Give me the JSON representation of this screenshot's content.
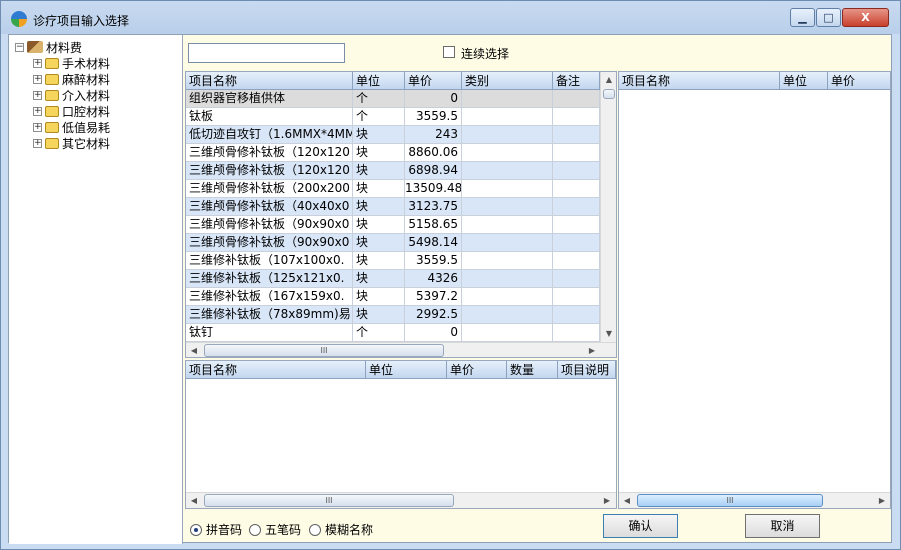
{
  "window": {
    "title": "诊疗项目输入选择",
    "minimize_glyph": "▁",
    "maximize_glyph": "□",
    "close_glyph": "X"
  },
  "tree": {
    "root": {
      "label": "材料费",
      "icon": "book-icon",
      "expander": "⊟"
    },
    "children": [
      {
        "label": "手术材料",
        "expander": "⊞"
      },
      {
        "label": "麻醉材料",
        "expander": "⊞"
      },
      {
        "label": "介入材料",
        "expander": "⊞"
      },
      {
        "label": "口腔材料",
        "expander": "⊞"
      },
      {
        "label": "低值易耗",
        "expander": "⊞"
      },
      {
        "label": "其它材料",
        "expander": "⊞"
      }
    ]
  },
  "search": {
    "value": ""
  },
  "continuous": {
    "label": "连续选择",
    "checked": false
  },
  "catalog": {
    "columns": [
      "项目名称",
      "单位",
      "单价",
      "类别",
      "备注"
    ],
    "rows": [
      [
        "组织器官移植供体",
        "个",
        "0",
        "",
        ""
      ],
      [
        "钛板",
        "个",
        "3559.5",
        "",
        ""
      ],
      [
        "低切迹自攻钉（1.6MMX*4MM",
        "块",
        "243",
        "",
        ""
      ],
      [
        "三维颅骨修补钛板（120x120",
        "块",
        "8860.06",
        "",
        ""
      ],
      [
        "三维颅骨修补钛板（120x120",
        "块",
        "6898.94",
        "",
        ""
      ],
      [
        "三维颅骨修补钛板（200x200",
        "块",
        "13509.48",
        "",
        ""
      ],
      [
        "三维颅骨修补钛板（40x40x0",
        "块",
        "3123.75",
        "",
        ""
      ],
      [
        "三维颅骨修补钛板（90x90x0",
        "块",
        "5158.65",
        "",
        ""
      ],
      [
        "三维颅骨修补钛板（90x90x0",
        "块",
        "5498.14",
        "",
        ""
      ],
      [
        "三维修补钛板（107x100x0.",
        "块",
        "3559.5",
        "",
        ""
      ],
      [
        "三维修补钛板（125x121x0.",
        "块",
        "4326",
        "",
        ""
      ],
      [
        "三维修补钛板（167x159x0.",
        "块",
        "5397.2",
        "",
        ""
      ],
      [
        "三维修补钛板（78x89mm)易:",
        "块",
        "2992.5",
        "",
        ""
      ],
      [
        "钛钉",
        "个",
        "0",
        "",
        ""
      ]
    ]
  },
  "selected": {
    "columns": [
      "项目名称",
      "单位",
      "单价",
      "数量",
      "项目说明"
    ]
  },
  "right": {
    "columns": [
      "项目名称",
      "单位",
      "单价"
    ]
  },
  "scroll": {
    "thumb_glyph": "III",
    "up": "▲",
    "down": "▼",
    "left": "◀",
    "right": "▶"
  },
  "input_mode": {
    "options": [
      {
        "label": "拼音码",
        "selected": true
      },
      {
        "label": "五笔码",
        "selected": false
      },
      {
        "label": "模糊名称",
        "selected": false
      }
    ]
  },
  "buttons": {
    "ok": "确认",
    "cancel": "取消"
  }
}
